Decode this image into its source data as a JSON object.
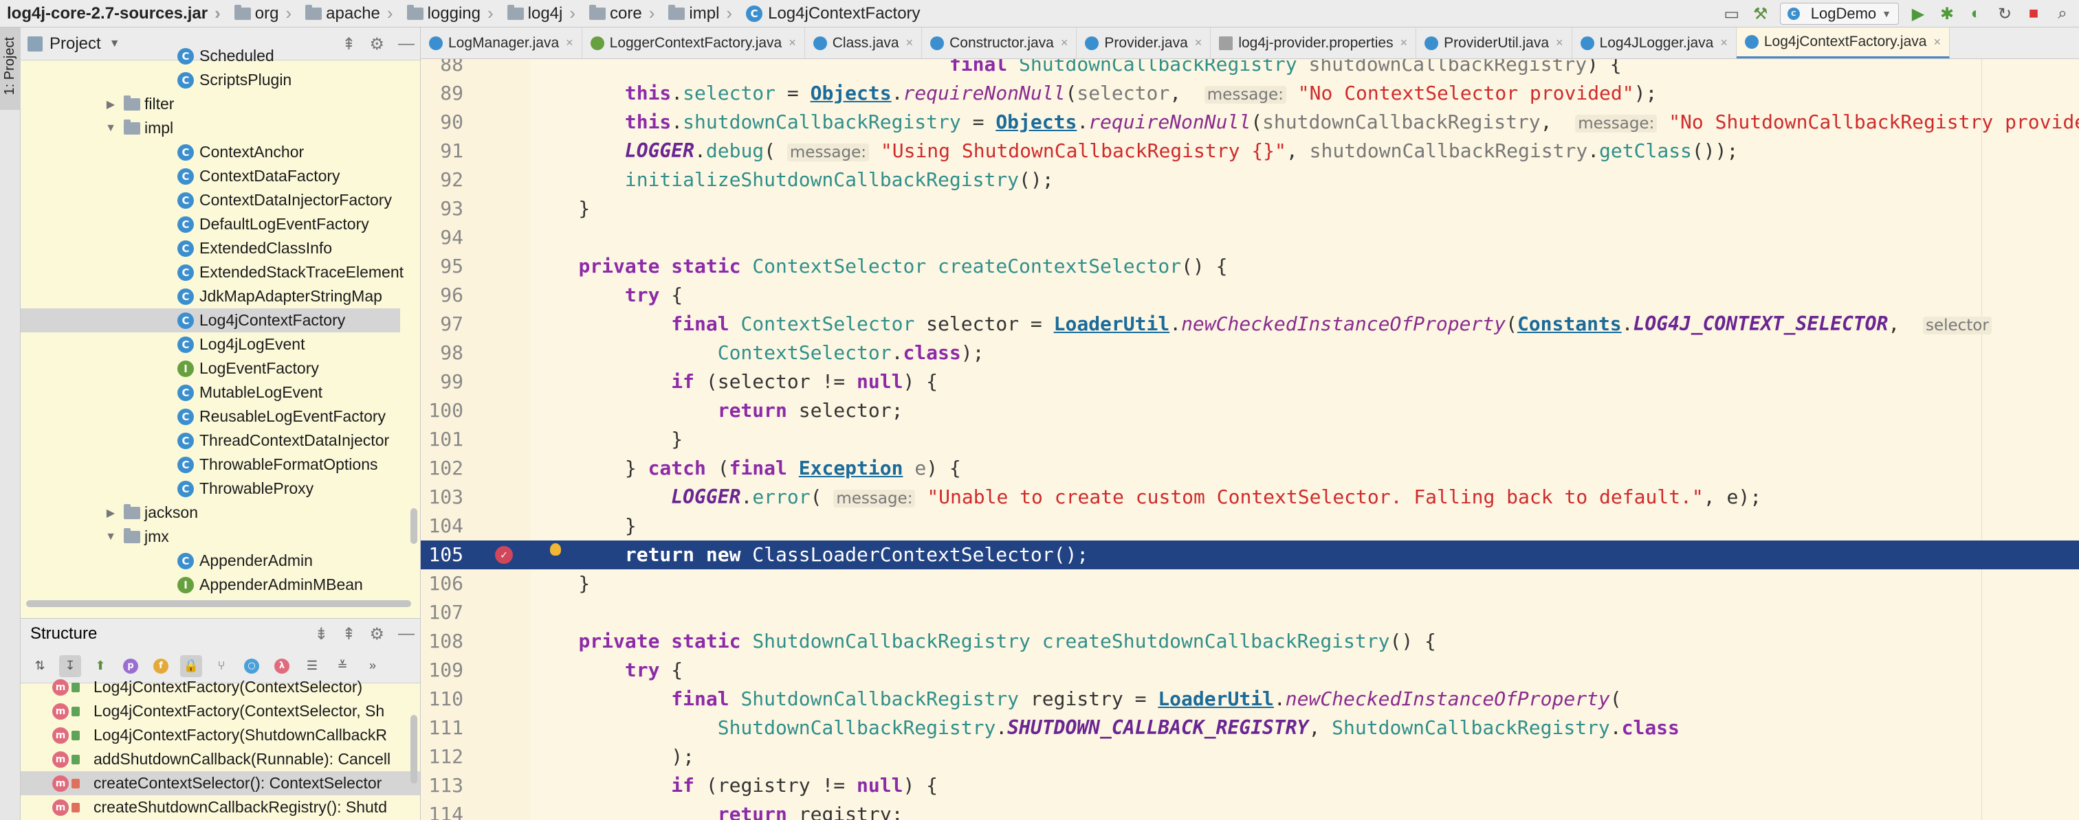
{
  "navbar": {
    "breadcrumbs": [
      {
        "label": "log4j-core-2.7-sources.jar",
        "icon": "jar-icon"
      },
      {
        "label": "org",
        "icon": "folder-icon"
      },
      {
        "label": "apache",
        "icon": "folder-icon"
      },
      {
        "label": "logging",
        "icon": "folder-icon"
      },
      {
        "label": "log4j",
        "icon": "folder-icon"
      },
      {
        "label": "core",
        "icon": "folder-icon"
      },
      {
        "label": "impl",
        "icon": "folder-icon"
      },
      {
        "label": "Log4jContextFactory",
        "icon": "class-icon"
      }
    ],
    "run_config": "LogDemo"
  },
  "left_strip": {
    "project_tab": "1: Project"
  },
  "project_panel": {
    "title": "Project",
    "tree": [
      {
        "label": "Scheduled",
        "kind": "class",
        "indent": 2
      },
      {
        "label": "ScriptsPlugin",
        "kind": "class",
        "indent": 2
      },
      {
        "label": "filter",
        "kind": "folder",
        "indent": 1,
        "arrow": "▶"
      },
      {
        "label": "impl",
        "kind": "folder",
        "indent": 1,
        "arrow": "▼"
      },
      {
        "label": "ContextAnchor",
        "kind": "class",
        "indent": 2
      },
      {
        "label": "ContextDataFactory",
        "kind": "class",
        "indent": 2
      },
      {
        "label": "ContextDataInjectorFactory",
        "kind": "class",
        "indent": 2
      },
      {
        "label": "DefaultLogEventFactory",
        "kind": "class",
        "indent": 2
      },
      {
        "label": "ExtendedClassInfo",
        "kind": "class",
        "indent": 2
      },
      {
        "label": "ExtendedStackTraceElement",
        "kind": "class",
        "indent": 2
      },
      {
        "label": "JdkMapAdapterStringMap",
        "kind": "class",
        "indent": 2
      },
      {
        "label": "Log4jContextFactory",
        "kind": "class",
        "indent": 2,
        "selected": true
      },
      {
        "label": "Log4jLogEvent",
        "kind": "class",
        "indent": 2
      },
      {
        "label": "LogEventFactory",
        "kind": "interface",
        "indent": 2
      },
      {
        "label": "MutableLogEvent",
        "kind": "class",
        "indent": 2
      },
      {
        "label": "ReusableLogEventFactory",
        "kind": "class",
        "indent": 2
      },
      {
        "label": "ThreadContextDataInjector",
        "kind": "class",
        "indent": 2
      },
      {
        "label": "ThrowableFormatOptions",
        "kind": "class",
        "indent": 2
      },
      {
        "label": "ThrowableProxy",
        "kind": "class",
        "indent": 2
      },
      {
        "label": "jackson",
        "kind": "folder",
        "indent": 1,
        "arrow": "▶"
      },
      {
        "label": "jmx",
        "kind": "folder",
        "indent": 1,
        "arrow": "▼"
      },
      {
        "label": "AppenderAdmin",
        "kind": "class",
        "indent": 2
      },
      {
        "label": "AppenderAdminMBean",
        "kind": "interface",
        "indent": 2
      }
    ]
  },
  "structure_panel": {
    "title": "Structure",
    "items": [
      {
        "label": "Log4jContextFactory(ContextSelector)",
        "lock": "green"
      },
      {
        "label": "Log4jContextFactory(ContextSelector, Sh",
        "lock": "green"
      },
      {
        "label": "Log4jContextFactory(ShutdownCallbackR",
        "lock": "green"
      },
      {
        "label": "addShutdownCallback(Runnable): Cancell",
        "lock": "green"
      },
      {
        "label": "createContextSelector(): ContextSelector",
        "lock": "red",
        "selected": true
      },
      {
        "label": "createShutdownCallbackRegistry(): Shutd",
        "lock": "red"
      }
    ]
  },
  "tabs": [
    {
      "label": "LogManager.java",
      "icon": "class"
    },
    {
      "label": "LoggerContextFactory.java",
      "icon": "interface"
    },
    {
      "label": "Class.java",
      "icon": "class"
    },
    {
      "label": "Constructor.java",
      "icon": "class"
    },
    {
      "label": "Provider.java",
      "icon": "class"
    },
    {
      "label": "log4j-provider.properties",
      "icon": "props"
    },
    {
      "label": "ProviderUtil.java",
      "icon": "class"
    },
    {
      "label": "Log4JLogger.java",
      "icon": "class"
    },
    {
      "label": "Log4jContextFactory.java",
      "icon": "class",
      "active": true
    }
  ],
  "editor": {
    "current_line": 105,
    "lines": [
      {
        "n": "88",
        "html": "                                    <span class=\"kw\">final</span> <span class=\"cls\">ShutdownCallbackRegistry</span> <span class=\"param\">shutdownCallbackRegistry</span>) {"
      },
      {
        "n": "89",
        "html": "        <span class=\"kw\">this</span>.<span class=\"cls\">selector</span> = <span class=\"link\">Objects</span>.<span class=\"ital-fn\">requireNonNull</span>(<span class=\"param\">selector</span>,  <span class=\"hint\">message:</span> <span class=\"str\">\"No ContextSelector provided\"</span>);"
      },
      {
        "n": "90",
        "html": "        <span class=\"kw\">this</span>.<span class=\"cls\">shutdownCallbackRegistry</span> = <span class=\"link\">Objects</span>.<span class=\"ital-fn\">requireNonNull</span>(<span class=\"param\">shutdownCallbackRegistry</span>,  <span class=\"hint\">message:</span> <span class=\"str\">\"No ShutdownCallbackRegistry provided\"</span>);"
      },
      {
        "n": "91",
        "html": "        <span class=\"ital-const\">LOGGER</span>.<span class=\"fn\">debug</span>( <span class=\"hint\">message:</span> <span class=\"str\">\"Using ShutdownCallbackRegistry {}\"</span>, <span class=\"param\">shutdownCallbackRegistry</span>.<span class=\"fn\">getClass</span>());"
      },
      {
        "n": "92",
        "html": "        <span class=\"fn\">initializeShutdownCallbackRegistry</span>();"
      },
      {
        "n": "93",
        "html": "    }"
      },
      {
        "n": "94",
        "html": ""
      },
      {
        "n": "95",
        "html": "    <span class=\"kw\">private static</span> <span class=\"cls\">ContextSelector</span> <span class=\"fn\">createContextSelector</span>() {"
      },
      {
        "n": "96",
        "html": "        <span class=\"kw\">try</span> {"
      },
      {
        "n": "97",
        "html": "            <span class=\"kw\">final</span> <span class=\"cls\">ContextSelector</span> selector = <span class=\"link\">LoaderUtil</span>.<span class=\"ital-fn\">newCheckedInstanceOfProperty</span>(<span class=\"link\">Constants</span>.<span class=\"ital-const\">LOG4J_CONTEXT_SELECTOR</span>,  <span class=\"hint\">selector</span>"
      },
      {
        "n": "98",
        "html": "                <span class=\"cls\">ContextSelector</span>.<span class=\"kw\">class</span>);"
      },
      {
        "n": "99",
        "html": "            <span class=\"kw\">if</span> (selector != <span class=\"kw\">null</span>) {"
      },
      {
        "n": "100",
        "html": "                <span class=\"kw\">return</span> selector;"
      },
      {
        "n": "101",
        "html": "            }"
      },
      {
        "n": "102",
        "html": "        } <span class=\"kw\">catch</span> (<span class=\"kw\">final</span> <span class=\"link\">Exception</span> <span class=\"param\">e</span>) {"
      },
      {
        "n": "103",
        "html": "            <span class=\"ital-const\">LOGGER</span>.<span class=\"fn\">error</span>( <span class=\"hint\">message:</span> <span class=\"str\">\"Unable to create custom ContextSelector. Falling back to default.\"</span>, e);"
      },
      {
        "n": "104",
        "html": "        }"
      },
      {
        "n": "105",
        "html": "        <span class=\"kw\">return new</span> <span class=\"cls\">ClassLoaderContextSelector</span>();"
      },
      {
        "n": "106",
        "html": "    }"
      },
      {
        "n": "107",
        "html": ""
      },
      {
        "n": "108",
        "html": "    <span class=\"kw\">private static</span> <span class=\"cls\">ShutdownCallbackRegistry</span> <span class=\"fn\">createShutdownCallbackRegistry</span>() {"
      },
      {
        "n": "109",
        "html": "        <span class=\"kw\">try</span> {"
      },
      {
        "n": "110",
        "html": "            <span class=\"kw\">final</span> <span class=\"cls\">ShutdownCallbackRegistry</span> registry = <span class=\"link\">LoaderUtil</span>.<span class=\"ital-fn\">newCheckedInstanceOfProperty</span>("
      },
      {
        "n": "111",
        "html": "                <span class=\"cls\">ShutdownCallbackRegistry</span>.<span class=\"ital-const\">SHUTDOWN_CALLBACK_REGISTRY</span>, <span class=\"cls\">ShutdownCallbackRegistry</span>.<span class=\"kw\">class</span>"
      },
      {
        "n": "112",
        "html": "            );"
      },
      {
        "n": "113",
        "html": "            <span class=\"kw\">if</span> (registry != <span class=\"kw\">null</span>) {"
      },
      {
        "n": "114",
        "html": "                <span class=\"kw\">return</span> registry;"
      }
    ]
  }
}
